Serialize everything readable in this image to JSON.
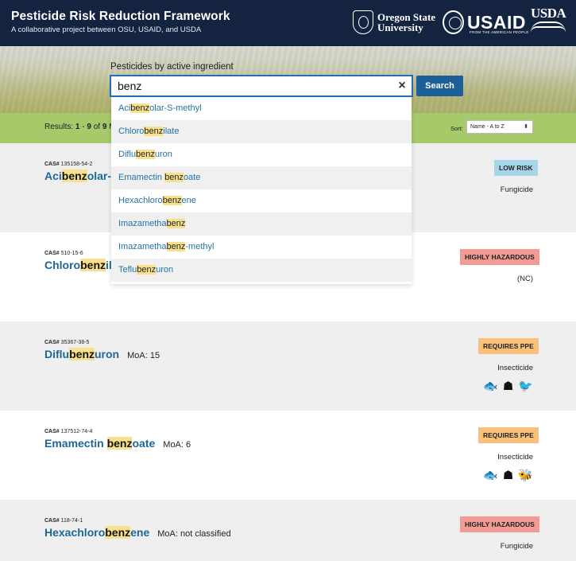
{
  "header": {
    "title": "Pesticide Risk Reduction Framework",
    "subtitle": "A collaborative project between OSU, USAID, and USDA",
    "logos": {
      "osu": [
        "Oregon State",
        "University"
      ],
      "usaid": "USAID",
      "usaid_tagline": "FROM THE AMERICAN PEOPLE",
      "usda": "USDA"
    }
  },
  "search": {
    "label": "Pesticides by active ingredient",
    "value": "benz",
    "button": "Search",
    "clear_icon": "×"
  },
  "autocomplete": [
    {
      "pre": "Aci",
      "hl": "benz",
      "post": "olar-S-methyl"
    },
    {
      "pre": "Chloro",
      "hl": "benz",
      "post": "ilate"
    },
    {
      "pre": "Diflu",
      "hl": "benz",
      "post": "uron"
    },
    {
      "pre": "Emamectin ",
      "hl": "benz",
      "post": "oate"
    },
    {
      "pre": "Hexachloro",
      "hl": "benz",
      "post": "ene"
    },
    {
      "pre": "Imazametha",
      "hl": "benz",
      "post": ""
    },
    {
      "pre": "Imazametha",
      "hl": "benz",
      "post": "-methyl"
    },
    {
      "pre": "Teflu",
      "hl": "benz",
      "post": "uron"
    }
  ],
  "results": {
    "prefix": "Results: ",
    "from": "1",
    "sep": " - ",
    "to": "9",
    "of": " of ",
    "total": "9",
    "suffix": " Ma",
    "sort_label": "Sort:",
    "sort_value": "Name - A to Z"
  },
  "cards": [
    {
      "cas_label": "CAS#",
      "cas": "135158-54-2",
      "pre": "Aci",
      "hl": "benz",
      "post": "olar-S-",
      "moa": "",
      "badge": "LOW RISK",
      "badge_type": "low",
      "type": "Fungicide",
      "icons": []
    },
    {
      "cas_label": "CAS#",
      "cas": "510-15-6",
      "pre": "Chloro",
      "hl": "benz",
      "post": "il",
      "moa": "",
      "badge": "HIGHLY HAZARDOUS",
      "badge_type": "hh",
      "type": "(NC)",
      "icons": []
    },
    {
      "cas_label": "CAS#",
      "cas": "35367-38-5",
      "pre": "Diflu",
      "hl": "benz",
      "post": "uron",
      "moa": "MoA: 15",
      "badge": "REQUIRES PPE",
      "badge_type": "ppe",
      "type": "Insecticide",
      "icons": [
        "fish-icon",
        "respirator-icon",
        "bird-icon"
      ]
    },
    {
      "cas_label": "CAS#",
      "cas": "137512-74-4",
      "pre": "Emamectin ",
      "hl": "benz",
      "post": "oate",
      "moa": "MoA: 6",
      "badge": "REQUIRES PPE",
      "badge_type": "ppe",
      "type": "Insecticide",
      "icons": [
        "fish-icon",
        "respirator-icon",
        "bee-icon"
      ]
    },
    {
      "cas_label": "CAS#",
      "cas": "118-74-1",
      "pre": "Hexachloro",
      "hl": "benz",
      "post": "ene",
      "moa": "MoA: not classified",
      "badge": "HIGHLY HAZARDOUS",
      "badge_type": "hh",
      "type": "Fungicide",
      "icons": []
    }
  ],
  "icon_glyphs": {
    "fish-icon": "🐟",
    "respirator-icon": "☗",
    "bird-icon": "🐦",
    "bee-icon": "🐝"
  }
}
